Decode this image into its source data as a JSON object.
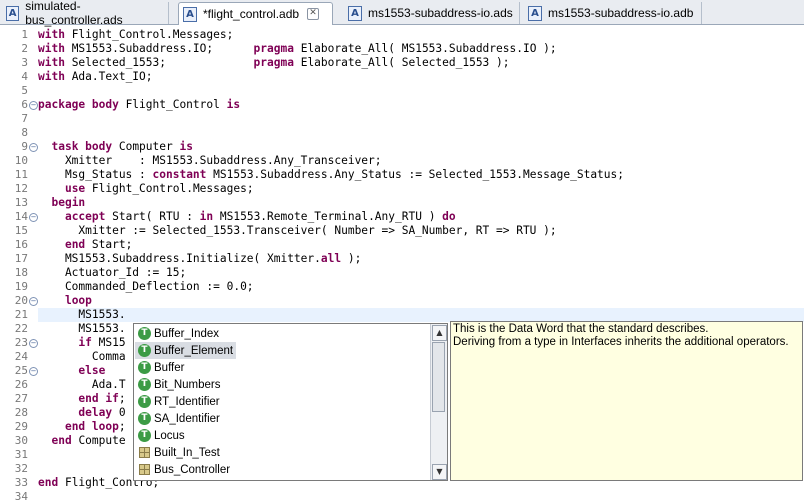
{
  "tabs": [
    {
      "icon": "ada-file-icon",
      "label": "simulated-bus_controller.ads",
      "active": false
    },
    {
      "icon": "ada-file-icon",
      "label": "*flight_control.adb",
      "active": true
    },
    {
      "icon": "ada-file-icon",
      "label": "ms1553-subaddress-io.ads",
      "active": false
    },
    {
      "icon": "ada-file-icon",
      "label": "ms1553-subaddress-io.adb",
      "active": false
    }
  ],
  "editor": {
    "current_line": 21,
    "line_numbers": [
      "1",
      "2",
      "3",
      "4",
      "5",
      "6",
      "7",
      "8",
      "9",
      "10",
      "11",
      "12",
      "13",
      "14",
      "15",
      "16",
      "17",
      "18",
      "19",
      "20",
      "21",
      "22",
      "23",
      "24",
      "25",
      "26",
      "27",
      "28",
      "29",
      "30",
      "31",
      "32",
      "33",
      "34"
    ],
    "lines": [
      [
        {
          "t": "with ",
          "k": true
        },
        {
          "t": "Flight_Control.Messages;"
        }
      ],
      [
        {
          "t": "with ",
          "k": true
        },
        {
          "t": "MS1553.Subaddress.IO;      "
        },
        {
          "t": "pragma",
          "k": true
        },
        {
          "t": " Elaborate_All( MS1553.Subaddress.IO );"
        }
      ],
      [
        {
          "t": "with ",
          "k": true
        },
        {
          "t": "Selected_1553;             "
        },
        {
          "t": "pragma",
          "k": true
        },
        {
          "t": " Elaborate_All( Selected_1553 );"
        }
      ],
      [
        {
          "t": "with ",
          "k": true
        },
        {
          "t": "Ada.Text_IO;"
        }
      ],
      [],
      [
        {
          "t": "package body",
          "k": true
        },
        {
          "t": " Flight_Control "
        },
        {
          "t": "is",
          "k": true
        }
      ],
      [],
      [],
      [
        {
          "t": "  "
        },
        {
          "t": "task body",
          "k": true
        },
        {
          "t": " Computer "
        },
        {
          "t": "is",
          "k": true
        }
      ],
      [
        {
          "t": "    Xmitter    : MS1553.Subaddress.Any_Transceiver;"
        }
      ],
      [
        {
          "t": "    Msg_Status : "
        },
        {
          "t": "constant",
          "k": true
        },
        {
          "t": " MS1553.Subaddress.Any_Status := Selected_1553.Message_Status;"
        }
      ],
      [
        {
          "t": "    "
        },
        {
          "t": "use",
          "k": true
        },
        {
          "t": " Flight_Control.Messages;"
        }
      ],
      [
        {
          "t": "  "
        },
        {
          "t": "begin",
          "k": true
        }
      ],
      [
        {
          "t": "    "
        },
        {
          "t": "accept",
          "k": true
        },
        {
          "t": " Start( RTU : "
        },
        {
          "t": "in",
          "k": true
        },
        {
          "t": " MS1553.Remote_Terminal.Any_RTU ) "
        },
        {
          "t": "do",
          "k": true
        }
      ],
      [
        {
          "t": "      Xmitter := Selected_1553.Transceiver( Number => SA_Number, RT => RTU );"
        }
      ],
      [
        {
          "t": "    "
        },
        {
          "t": "end",
          "k": true
        },
        {
          "t": " Start;"
        }
      ],
      [
        {
          "t": "    MS1553.Subaddress.Initialize( Xmitter."
        },
        {
          "t": "all",
          "k": true
        },
        {
          "t": " );"
        }
      ],
      [
        {
          "t": "    Actuator_Id := 15;"
        }
      ],
      [
        {
          "t": "    Commanded_Deflection := 0.0;"
        }
      ],
      [
        {
          "t": "    "
        },
        {
          "t": "loop",
          "k": true
        }
      ],
      [
        {
          "t": "      MS1553."
        }
      ],
      [
        {
          "t": "      MS1553."
        }
      ],
      [
        {
          "t": "      "
        },
        {
          "t": "if",
          "k": true
        },
        {
          "t": " MS15"
        }
      ],
      [
        {
          "t": "        Comma"
        }
      ],
      [
        {
          "t": "      "
        },
        {
          "t": "else",
          "k": true
        }
      ],
      [
        {
          "t": "        Ada.T"
        }
      ],
      [
        {
          "t": "      "
        },
        {
          "t": "end if",
          "k": true
        },
        {
          "t": ";"
        }
      ],
      [
        {
          "t": "      "
        },
        {
          "t": "delay",
          "k": true
        },
        {
          "t": " 0"
        }
      ],
      [
        {
          "t": "    "
        },
        {
          "t": "end loop",
          "k": true
        },
        {
          "t": ";"
        }
      ],
      [
        {
          "t": "  "
        },
        {
          "t": "end",
          "k": true
        },
        {
          "t": " Compute"
        }
      ],
      [],
      [],
      [
        {
          "t": "end",
          "k": true
        },
        {
          "t": " Flight_Contro;"
        }
      ],
      []
    ],
    "fold_markers": [
      "6",
      "9",
      "14",
      "20",
      "23",
      "25"
    ]
  },
  "completion": {
    "items": [
      {
        "icon": "type-icon",
        "glyph": "T",
        "label": "Buffer_Index",
        "selected": false
      },
      {
        "icon": "type-icon",
        "glyph": "T",
        "label": "Buffer_Element",
        "selected": true
      },
      {
        "icon": "type-icon",
        "glyph": "T",
        "label": "Buffer",
        "selected": false
      },
      {
        "icon": "type-icon",
        "glyph": "T",
        "label": "Bit_Numbers",
        "selected": false
      },
      {
        "icon": "type-icon",
        "glyph": "T",
        "label": "RT_Identifier",
        "selected": false
      },
      {
        "icon": "type-icon",
        "glyph": "T",
        "label": "SA_Identifier",
        "selected": false
      },
      {
        "icon": "type-icon",
        "glyph": "T",
        "label": "Locus",
        "selected": false
      },
      {
        "icon": "package-icon",
        "glyph": "",
        "label": "Built_In_Test",
        "selected": false
      },
      {
        "icon": "package-icon",
        "glyph": "",
        "label": "Bus_Controller",
        "selected": false
      }
    ],
    "scroll_up": "▲",
    "scroll_down": "▼"
  },
  "doc_tooltip": {
    "line1": "This is the Data Word that the standard describes.",
    "line2": "Deriving from a type in Interfaces inherits the additional operators."
  },
  "colors": {
    "keyword": "#7f0055",
    "current_line": "#e8f2fe",
    "tooltip_bg": "#ffffe1",
    "type_icon": "#3c9b45"
  }
}
